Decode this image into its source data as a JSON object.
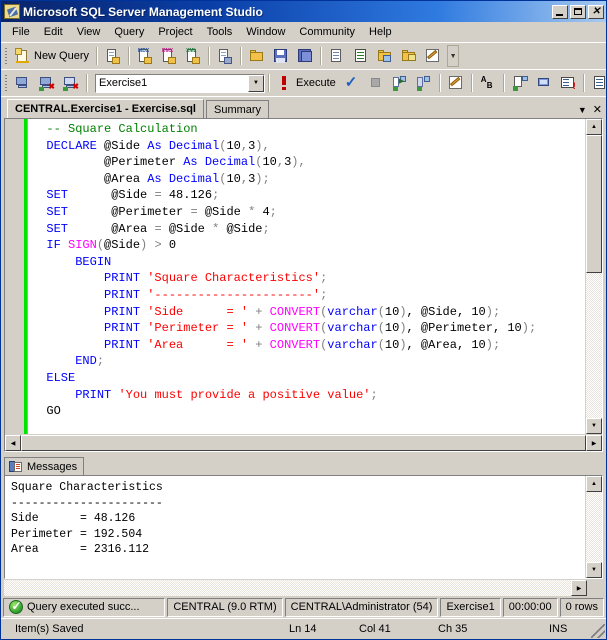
{
  "window": {
    "title": "Microsoft SQL Server Management Studio",
    "icon": "ssms-icon",
    "minimize_label": "Minimize",
    "maximize_label": "Maximize",
    "close_label": "Close"
  },
  "menubar": {
    "items": [
      {
        "label": "File"
      },
      {
        "label": "Edit"
      },
      {
        "label": "View"
      },
      {
        "label": "Query"
      },
      {
        "label": "Project"
      },
      {
        "label": "Tools"
      },
      {
        "label": "Window"
      },
      {
        "label": "Community"
      },
      {
        "label": "Help"
      }
    ]
  },
  "standard_toolbar": {
    "new_query_label": "New Query",
    "new_query_icon": "new-query-icon",
    "buttons": [
      {
        "name": "new-database-engine-query",
        "icon": "page-yellow-icon",
        "tag": ""
      },
      {
        "name": "new-analysis-services-mdx-query",
        "icon": "page-mdx-icon",
        "tag": "MDX"
      },
      {
        "name": "new-analysis-services-dmx-query",
        "icon": "page-dmx-icon",
        "tag": "DMX"
      },
      {
        "name": "new-analysis-services-xmla-query",
        "icon": "page-xmla-icon",
        "tag": "XMLA"
      },
      {
        "name": "new-sql-server-compact-query",
        "icon": "page-compact-icon",
        "tag": ""
      },
      {
        "name": "open-file",
        "icon": "open-folder-icon",
        "tag": ""
      },
      {
        "name": "save",
        "icon": "save-icon",
        "tag": ""
      },
      {
        "name": "save-all",
        "icon": "save-all-icon",
        "tag": ""
      },
      {
        "name": "copy",
        "icon": "copy-icon",
        "tag": ""
      },
      {
        "name": "registered-servers",
        "icon": "registered-servers-icon",
        "tag": ""
      },
      {
        "name": "object-explorer",
        "icon": "object-explorer-icon",
        "tag": ""
      },
      {
        "name": "template-explorer",
        "icon": "template-explorer-icon",
        "tag": ""
      },
      {
        "name": "solution-explorer",
        "icon": "solution-explorer-icon",
        "tag": ""
      }
    ],
    "overflow_label": "Toolbar Options"
  },
  "query_toolbar": {
    "connect_icon": "connect-icon",
    "disconnect_icon": "disconnect-icon",
    "change_connection_icon": "change-connection-icon",
    "database_combo": {
      "value": "Exercise1",
      "placeholder": "Available Databases"
    },
    "execute_label": "Execute",
    "execute_icon": "execute-icon",
    "parse_icon": "parse-check-icon",
    "stop_icon": "stop-icon",
    "display_estimated_plan_icon": "estimated-execution-plan-icon",
    "include_actual_plan_icon": "actual-execution-plan-icon",
    "design_query_icon": "design-query-in-editor-icon",
    "specify_values_icon": "specify-values-for-template-parameters-icon",
    "include_client_statistics_icon": "include-client-statistics-icon",
    "results_to_grid_icon": "results-to-grid-icon",
    "results_to_text_icon": "results-to-text-icon",
    "results_to_file_icon": "results-to-file-icon",
    "overflow_label": "Toolbar Options"
  },
  "document_tabs": {
    "tabs": [
      {
        "label": "CENTRAL.Exercise1 - Exercise.sql",
        "active": true
      },
      {
        "label": "Summary",
        "active": false
      }
    ],
    "menu_icon": "chevron-down-icon",
    "close_icon": "close-icon"
  },
  "editor": {
    "lines": [
      [
        {
          "t": "  ",
          "c": "pl"
        },
        {
          "t": "-- Square Calculation",
          "c": "cm"
        }
      ],
      [
        {
          "t": "  ",
          "c": "pl"
        },
        {
          "t": "DECLARE",
          "c": "k"
        },
        {
          "t": " @Side ",
          "c": "pl"
        },
        {
          "t": "As",
          "c": "k"
        },
        {
          "t": " ",
          "c": "pl"
        },
        {
          "t": "Decimal",
          "c": "k"
        },
        {
          "t": "(",
          "c": "op"
        },
        {
          "t": "10",
          "c": "pl"
        },
        {
          "t": ",",
          "c": "op"
        },
        {
          "t": "3",
          "c": "pl"
        },
        {
          "t": ")",
          "c": "op"
        },
        {
          "t": ",",
          "c": "op"
        }
      ],
      [
        {
          "t": "          @Perimeter ",
          "c": "pl"
        },
        {
          "t": "As",
          "c": "k"
        },
        {
          "t": " ",
          "c": "pl"
        },
        {
          "t": "Decimal",
          "c": "k"
        },
        {
          "t": "(",
          "c": "op"
        },
        {
          "t": "10",
          "c": "pl"
        },
        {
          "t": ",",
          "c": "op"
        },
        {
          "t": "3",
          "c": "pl"
        },
        {
          "t": ")",
          "c": "op"
        },
        {
          "t": ",",
          "c": "op"
        }
      ],
      [
        {
          "t": "          @Area ",
          "c": "pl"
        },
        {
          "t": "As",
          "c": "k"
        },
        {
          "t": " ",
          "c": "pl"
        },
        {
          "t": "Decimal",
          "c": "k"
        },
        {
          "t": "(",
          "c": "op"
        },
        {
          "t": "10",
          "c": "pl"
        },
        {
          "t": ",",
          "c": "op"
        },
        {
          "t": "3",
          "c": "pl"
        },
        {
          "t": ")",
          "c": "op"
        },
        {
          "t": ";",
          "c": "op"
        }
      ],
      [
        {
          "t": "  ",
          "c": "pl"
        },
        {
          "t": "SET",
          "c": "k"
        },
        {
          "t": "      @Side ",
          "c": "pl"
        },
        {
          "t": "=",
          "c": "op"
        },
        {
          "t": " 48.126",
          "c": "pl"
        },
        {
          "t": ";",
          "c": "op"
        }
      ],
      [
        {
          "t": "  ",
          "c": "pl"
        },
        {
          "t": "SET",
          "c": "k"
        },
        {
          "t": "      @Perimeter ",
          "c": "pl"
        },
        {
          "t": "=",
          "c": "op"
        },
        {
          "t": " @Side ",
          "c": "pl"
        },
        {
          "t": "*",
          "c": "op"
        },
        {
          "t": " 4",
          "c": "pl"
        },
        {
          "t": ";",
          "c": "op"
        }
      ],
      [
        {
          "t": "  ",
          "c": "pl"
        },
        {
          "t": "SET",
          "c": "k"
        },
        {
          "t": "      @Area ",
          "c": "pl"
        },
        {
          "t": "=",
          "c": "op"
        },
        {
          "t": " @Side ",
          "c": "pl"
        },
        {
          "t": "*",
          "c": "op"
        },
        {
          "t": " @Side",
          "c": "pl"
        },
        {
          "t": ";",
          "c": "op"
        }
      ],
      [
        {
          "t": "  ",
          "c": "pl"
        },
        {
          "t": "IF",
          "c": "k"
        },
        {
          "t": " ",
          "c": "pl"
        },
        {
          "t": "SIGN",
          "c": "fn"
        },
        {
          "t": "(",
          "c": "op"
        },
        {
          "t": "@Side",
          "c": "pl"
        },
        {
          "t": ")",
          "c": "op"
        },
        {
          "t": " ",
          "c": "pl"
        },
        {
          "t": ">",
          "c": "op"
        },
        {
          "t": " 0",
          "c": "pl"
        }
      ],
      [
        {
          "t": "      ",
          "c": "pl"
        },
        {
          "t": "BEGIN",
          "c": "k"
        }
      ],
      [
        {
          "t": "          ",
          "c": "pl"
        },
        {
          "t": "PRINT",
          "c": "k"
        },
        {
          "t": " ",
          "c": "pl"
        },
        {
          "t": "'Square Characteristics'",
          "c": "str"
        },
        {
          "t": ";",
          "c": "op"
        }
      ],
      [
        {
          "t": "          ",
          "c": "pl"
        },
        {
          "t": "PRINT",
          "c": "k"
        },
        {
          "t": " ",
          "c": "pl"
        },
        {
          "t": "'----------------------'",
          "c": "str"
        },
        {
          "t": ";",
          "c": "op"
        }
      ],
      [
        {
          "t": "          ",
          "c": "pl"
        },
        {
          "t": "PRINT",
          "c": "k"
        },
        {
          "t": " ",
          "c": "pl"
        },
        {
          "t": "'Side      = '",
          "c": "str"
        },
        {
          "t": " ",
          "c": "pl"
        },
        {
          "t": "+",
          "c": "op"
        },
        {
          "t": " ",
          "c": "pl"
        },
        {
          "t": "CONVERT",
          "c": "fn"
        },
        {
          "t": "(",
          "c": "op"
        },
        {
          "t": "varchar",
          "c": "k"
        },
        {
          "t": "(",
          "c": "op"
        },
        {
          "t": "10",
          "c": "pl"
        },
        {
          "t": ")",
          "c": "op"
        },
        {
          "t": ", @Side, 10",
          "c": "pl"
        },
        {
          "t": ")",
          "c": "op"
        },
        {
          "t": ";",
          "c": "op"
        }
      ],
      [
        {
          "t": "          ",
          "c": "pl"
        },
        {
          "t": "PRINT",
          "c": "k"
        },
        {
          "t": " ",
          "c": "pl"
        },
        {
          "t": "'Perimeter = '",
          "c": "str"
        },
        {
          "t": " ",
          "c": "pl"
        },
        {
          "t": "+",
          "c": "op"
        },
        {
          "t": " ",
          "c": "pl"
        },
        {
          "t": "CONVERT",
          "c": "fn"
        },
        {
          "t": "(",
          "c": "op"
        },
        {
          "t": "varchar",
          "c": "k"
        },
        {
          "t": "(",
          "c": "op"
        },
        {
          "t": "10",
          "c": "pl"
        },
        {
          "t": ")",
          "c": "op"
        },
        {
          "t": ", @Perimeter, 10",
          "c": "pl"
        },
        {
          "t": ")",
          "c": "op"
        },
        {
          "t": ";",
          "c": "op"
        }
      ],
      [
        {
          "t": "          ",
          "c": "pl"
        },
        {
          "t": "PRINT",
          "c": "k"
        },
        {
          "t": " ",
          "c": "pl"
        },
        {
          "t": "'Area      = '",
          "c": "str"
        },
        {
          "t": " ",
          "c": "pl"
        },
        {
          "t": "+",
          "c": "op"
        },
        {
          "t": " ",
          "c": "pl"
        },
        {
          "t": "CONVERT",
          "c": "fn"
        },
        {
          "t": "(",
          "c": "op"
        },
        {
          "t": "varchar",
          "c": "k"
        },
        {
          "t": "(",
          "c": "op"
        },
        {
          "t": "10",
          "c": "pl"
        },
        {
          "t": ")",
          "c": "op"
        },
        {
          "t": ", @Area, 10",
          "c": "pl"
        },
        {
          "t": ")",
          "c": "op"
        },
        {
          "t": ";",
          "c": "op"
        }
      ],
      [
        {
          "t": "      ",
          "c": "pl"
        },
        {
          "t": "END",
          "c": "k"
        },
        {
          "t": ";",
          "c": "op"
        }
      ],
      [
        {
          "t": "  ",
          "c": "pl"
        },
        {
          "t": "ELSE",
          "c": "k"
        }
      ],
      [
        {
          "t": "      ",
          "c": "pl"
        },
        {
          "t": "PRINT",
          "c": "k"
        },
        {
          "t": " ",
          "c": "pl"
        },
        {
          "t": "'You must provide a positive value'",
          "c": "str"
        },
        {
          "t": ";",
          "c": "op"
        }
      ],
      [
        {
          "t": "  GO",
          "c": "pl"
        }
      ]
    ]
  },
  "results": {
    "tabs": [
      {
        "label": "Messages",
        "icon": "messages-icon",
        "active": true
      }
    ],
    "messages_text": "Square Characteristics\n----------------------\nSide      = 48.126\nPerimeter = 192.504\nArea      = 2316.112\n"
  },
  "status_bar": {
    "query_status": "Query executed succ...",
    "query_status_icon": "success-check-icon",
    "server": "CENTRAL (9.0 RTM)",
    "user": "CENTRAL\\Administrator (54)",
    "database": "Exercise1",
    "elapsed": "00:00:00",
    "rows": "0 rows"
  },
  "status_bar_secondary": {
    "message": "Item(s) Saved",
    "line": "Ln 14",
    "column": "Col 41",
    "character": "Ch 35",
    "insert_mode": "INS"
  },
  "colors": {
    "title_start": "#0a246a",
    "title_end": "#a6caf0",
    "chrome": "#d4d0c8",
    "comment_green": "#008000",
    "keyword_blue": "#0000ff",
    "string_red": "#ff0000",
    "function_magenta": "#ff00ff",
    "change_bar": "#00e400"
  }
}
